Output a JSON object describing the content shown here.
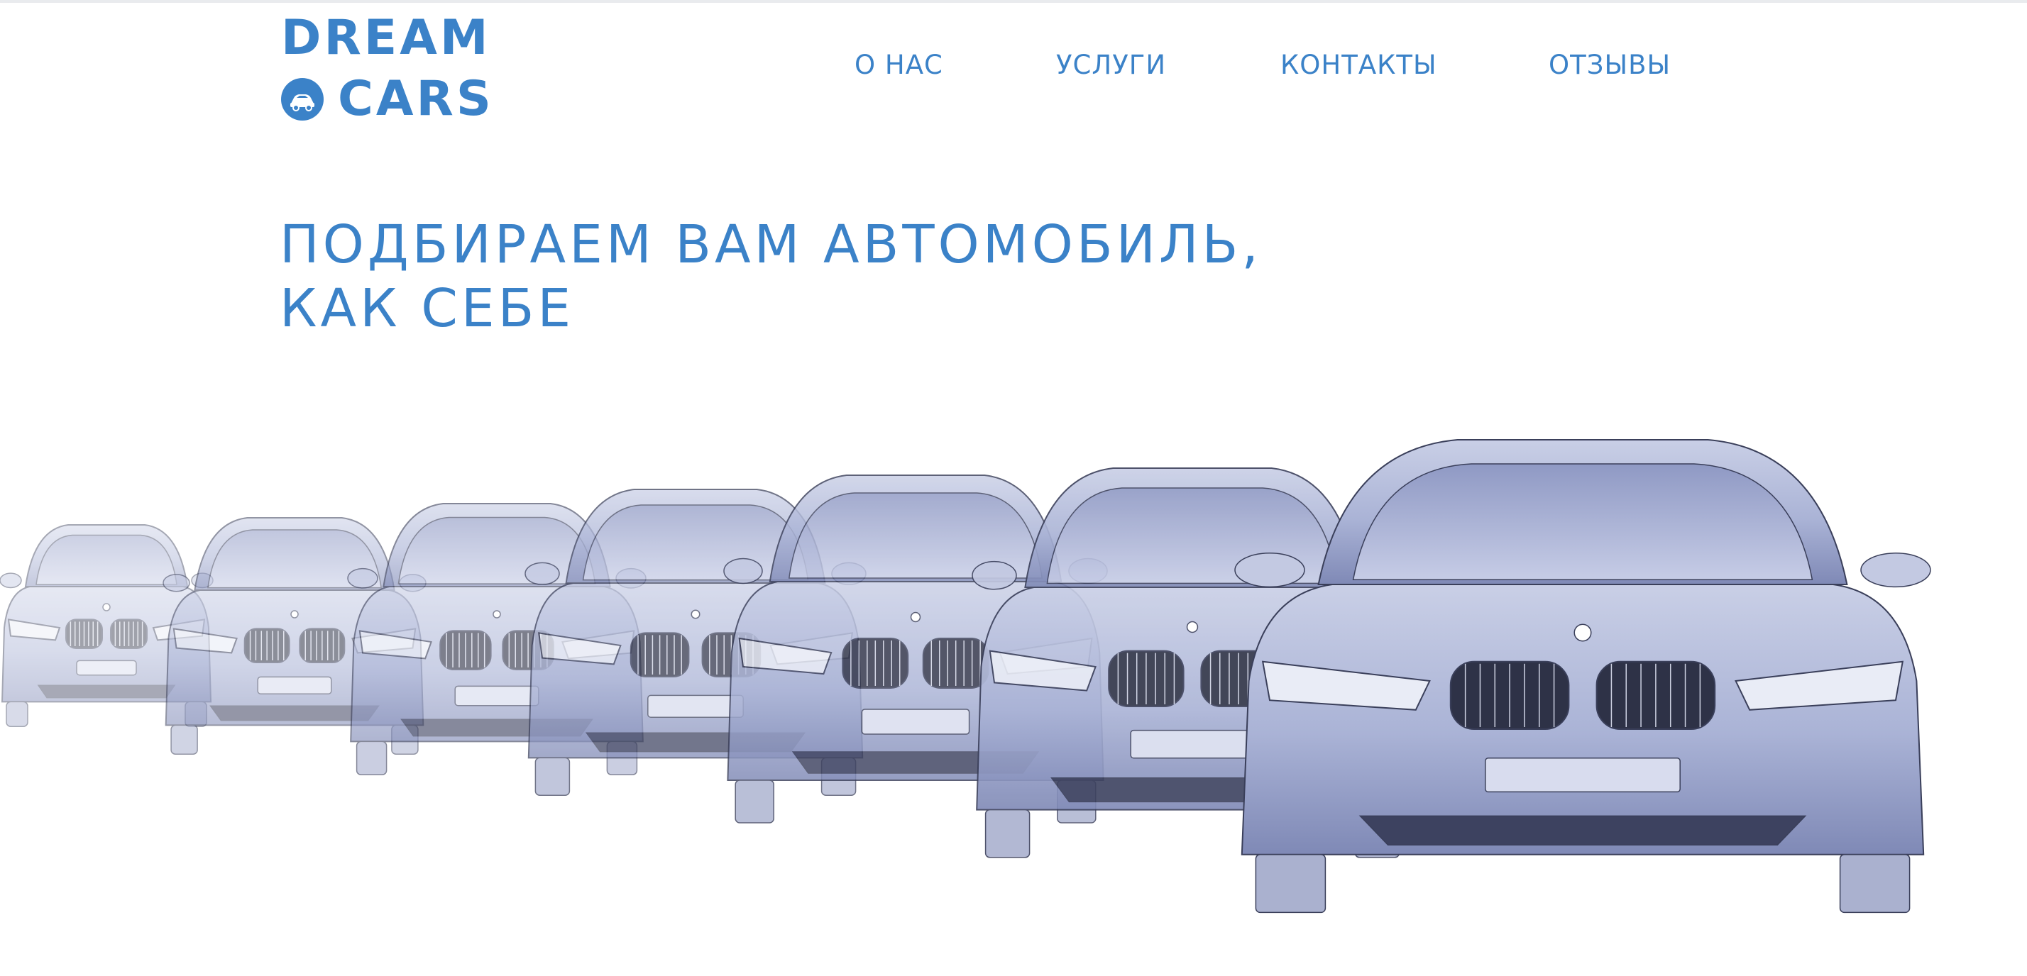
{
  "logo": {
    "line1": "DREAM",
    "line2": "CARS",
    "badge_icon": "car-icon",
    "color": "#3b82c8"
  },
  "nav": {
    "items": [
      {
        "label": "О НАС"
      },
      {
        "label": "УСЛУГИ"
      },
      {
        "label": "КОНТАКТЫ"
      },
      {
        "label": "ОТЗЫВЫ"
      }
    ]
  },
  "hero": {
    "headline_line1": "ПОДБИРАЕМ ВАМ АВТОМОБИЛЬ,",
    "headline_line2": "КАК СЕБЕ",
    "illustration": "row-of-car-sketches"
  },
  "colors": {
    "accent": "#3b82c8",
    "car_body": "#aeb6d6",
    "car_shade": "#7e88b4",
    "car_line": "#3a3f5a",
    "background": "#ffffff"
  }
}
